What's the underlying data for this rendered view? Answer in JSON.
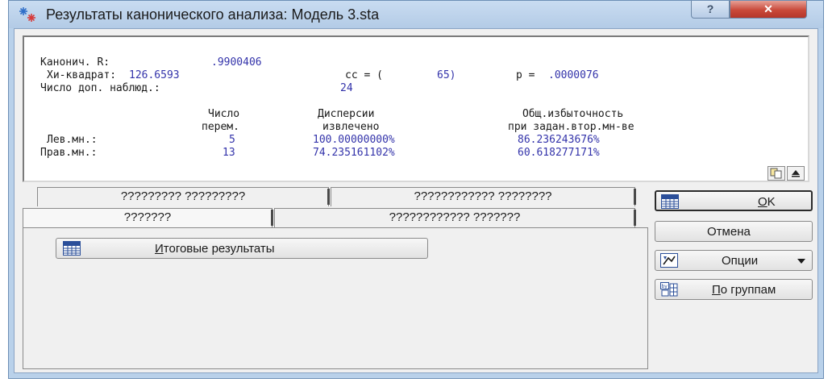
{
  "window": {
    "title": "Результаты канонического анализа: Модель 3.sta",
    "help_label": "?",
    "close_label": "✕"
  },
  "results": {
    "canon_r_label": "Канонич. R:",
    "canon_r_value": ".9900406",
    "chi_label": "Хи-квадрат:",
    "chi_value": "126.6593",
    "df_label": "cc = (",
    "df_value": "65)",
    "p_label": "p =",
    "p_value": ".0000076",
    "obs_label": "Число доп. наблюд.:",
    "obs_value": "24",
    "col_vars_1": "Число",
    "col_vars_2": "перем.",
    "col_var_1": "Дисперсии",
    "col_var_2": "извлечено",
    "col_red_1": "Общ.избыточность",
    "col_red_2": "при задан.втор.мн-ве",
    "rows": [
      {
        "label": "Лев.мн.:",
        "vars": "5",
        "variance": "100.00000000%",
        "redundancy": "86.236243676%"
      },
      {
        "label": "Прав.мн.:",
        "vars": "13",
        "variance": "74.235161102%",
        "redundancy": "60.618277171%"
      }
    ]
  },
  "tabs": {
    "row1": [
      "????????? ?????????",
      "???????????? ????????"
    ],
    "row2": [
      "???????",
      "???????????? ???????"
    ]
  },
  "panel": {
    "summary_label": "Итоговые результаты"
  },
  "side": {
    "ok_label": "OK",
    "cancel_label": "Отмена",
    "options_label": "Опции",
    "groups_label": "По группам"
  }
}
